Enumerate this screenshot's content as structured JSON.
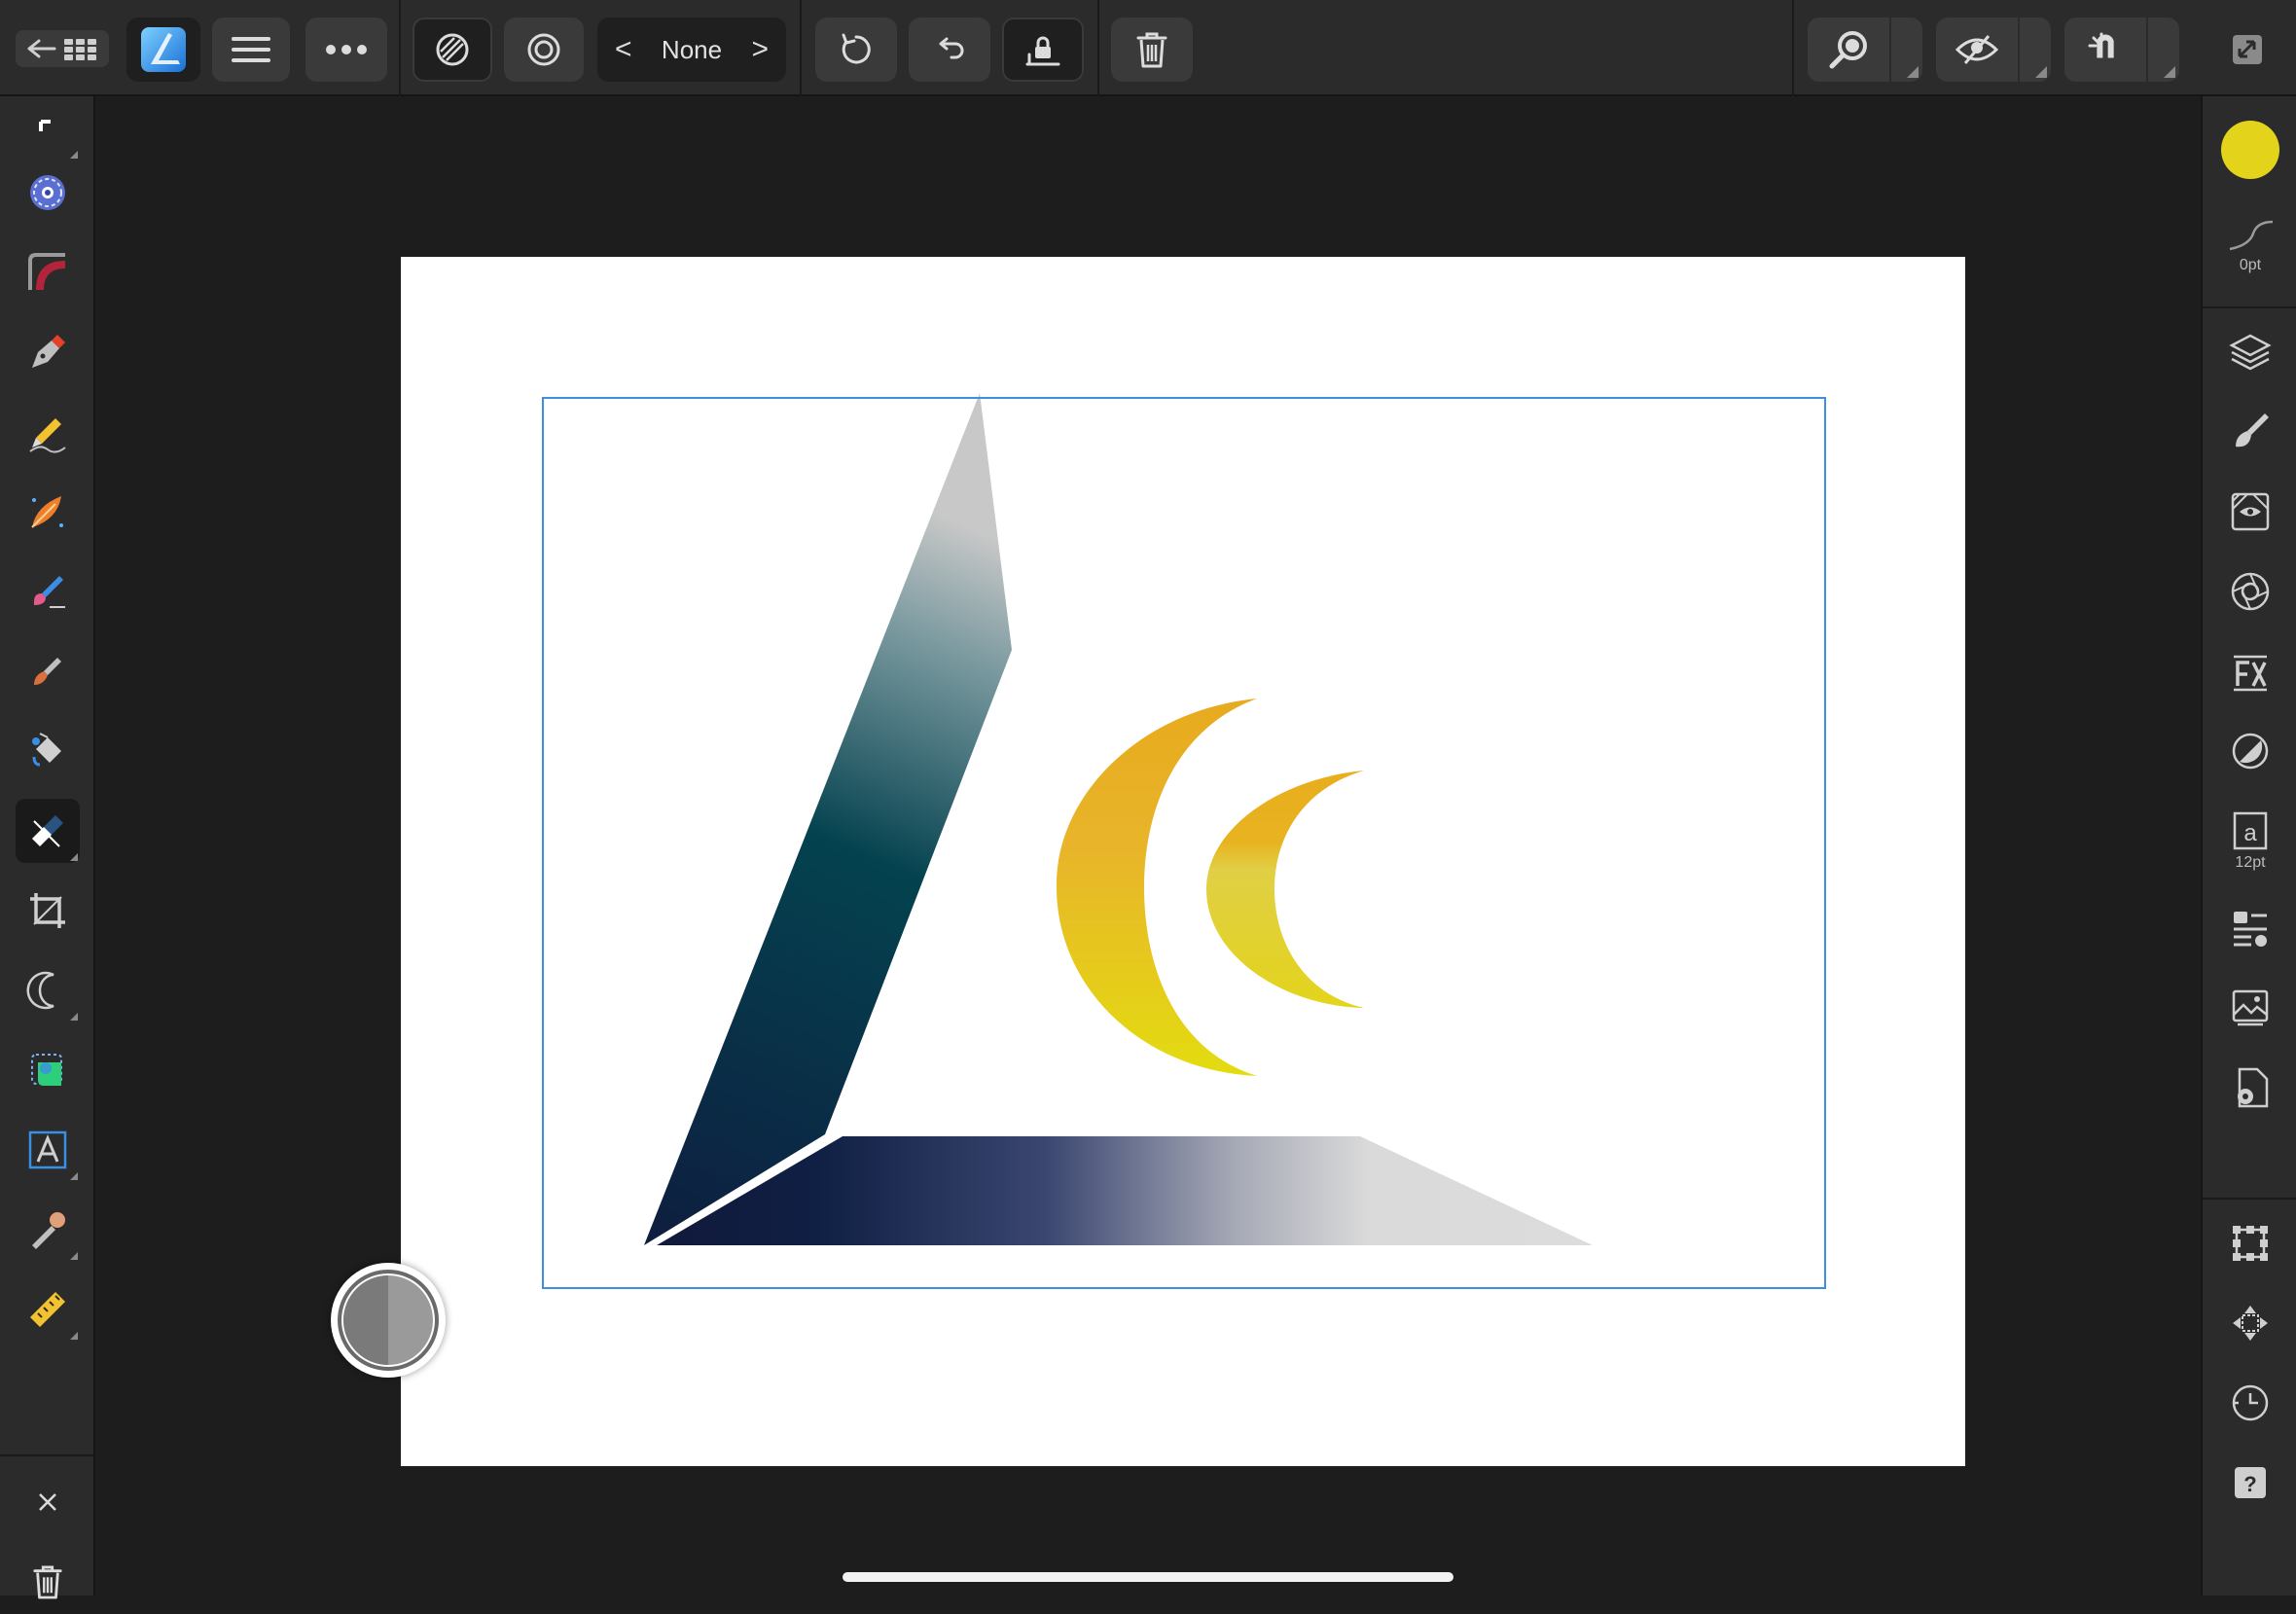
{
  "app": {
    "name": "Affinity Designer",
    "accent_color": "#2f8de4"
  },
  "toolbar": {
    "icons": [
      "back-to-documents-icon",
      "affinity-logo-icon",
      "menu-icon",
      "more-icon",
      "mode-hatch-icon",
      "mode-circles-icon",
      "undo-icon",
      "redo-icon",
      "lock-icon",
      "delete-icon",
      "zoom-icon",
      "view-mode-icon",
      "snapping-icon",
      "fullscreen-icon"
    ],
    "selection_nav": {
      "label": "None",
      "prev": "<",
      "next": ">"
    }
  },
  "left_tools": {
    "items": [
      "move-tool-icon",
      "node-tool-icon",
      "corner-tool-icon",
      "pen-tool-icon",
      "pencil-tool-icon",
      "vector-brush-icon",
      "pixel-brush-icon",
      "paint-brush-icon",
      "fill-tool-icon",
      "transparency-tool-icon",
      "crop-tool-icon",
      "shape-crescent-icon",
      "frame-tool-icon",
      "text-tool-icon",
      "color-picker-icon",
      "ruler-tool-icon"
    ],
    "active": "transparency-tool-icon",
    "footer": [
      "close-icon",
      "trash-icon"
    ]
  },
  "right_panel": {
    "fill_color": "#e3d41b",
    "stroke_width_label": "0pt",
    "text_size_label": "12pt",
    "studios": [
      "layers-icon",
      "brushes-icon",
      "styles-icon",
      "appearance-icon",
      "fx-icon",
      "adjustments-icon",
      "text-styles-icon",
      "assets-icon",
      "stock-icon",
      "document-setup-icon"
    ],
    "bottom": [
      "transform-icon",
      "navigator-icon",
      "history-icon",
      "help-icon"
    ],
    "help_glyph": "?"
  },
  "canvas": {
    "background": "#ffffff",
    "selection_color": "#3d8fe0",
    "artwork_colors": {
      "triangle_dark": "#0e1d3f",
      "triangle_teal": "#04424f",
      "triangle_light": "#c8c8c8",
      "crescent_orange": "#e9ad1e",
      "crescent_yellow": "#e3d41b"
    }
  }
}
